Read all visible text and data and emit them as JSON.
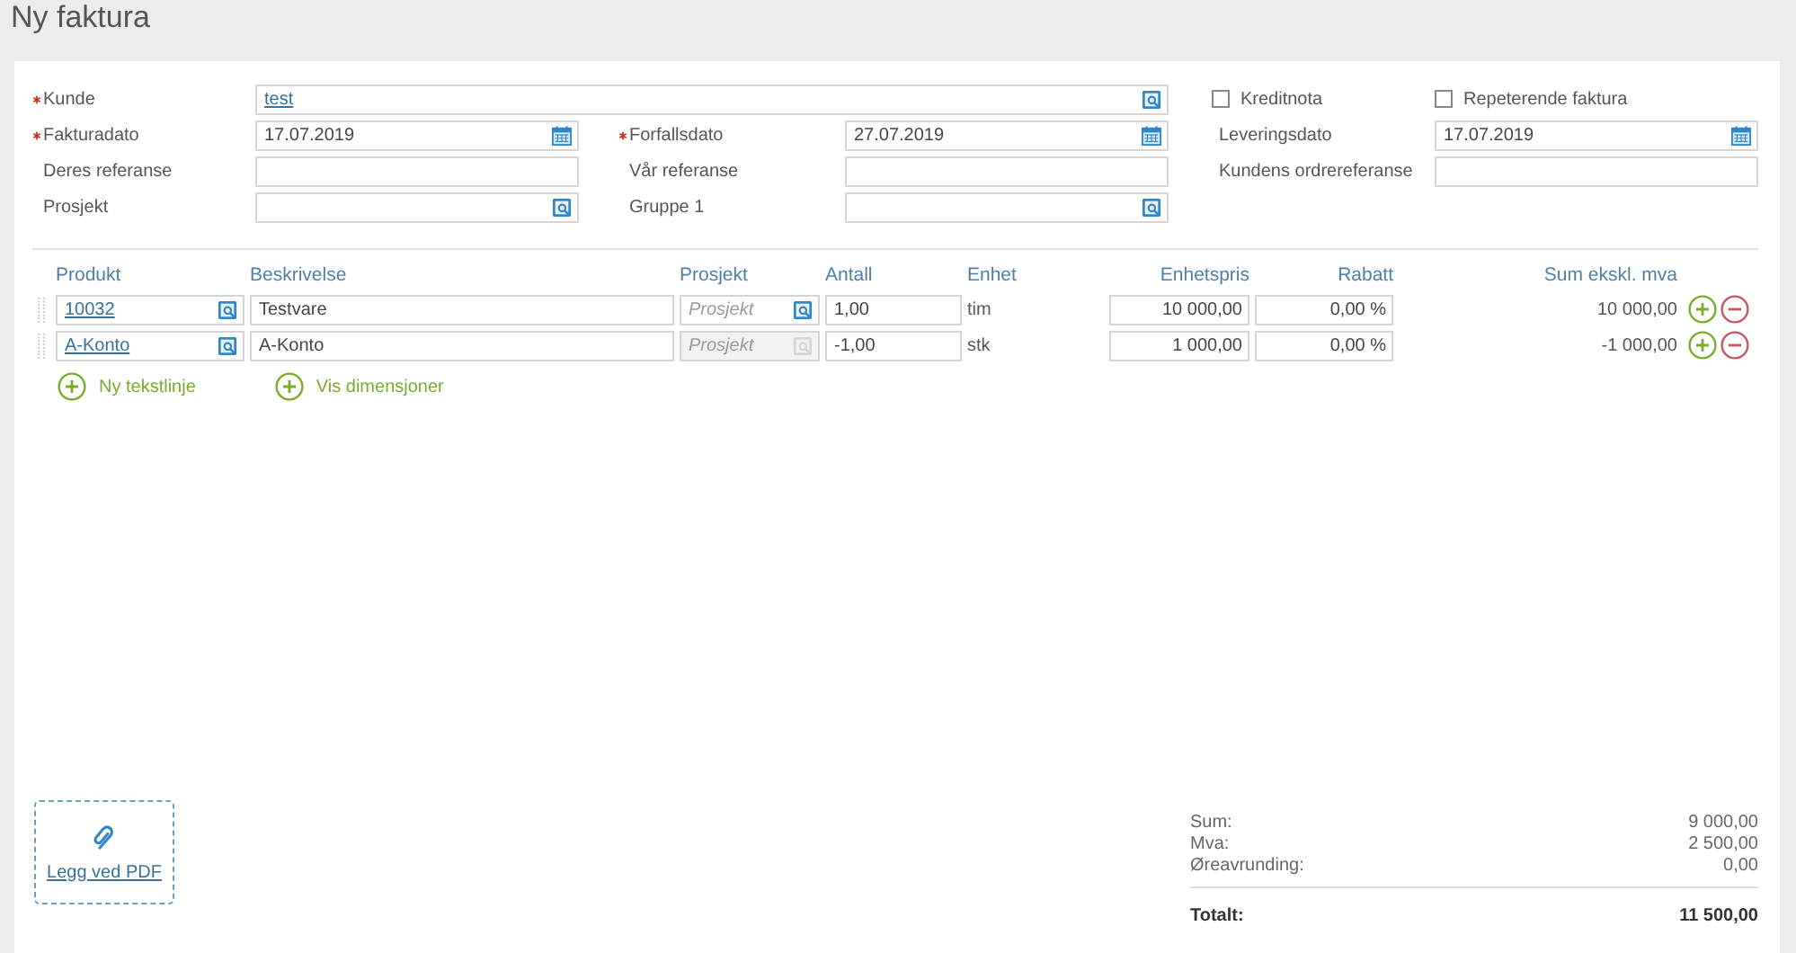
{
  "title": "Ny faktura",
  "form_rows": [
    [
      {
        "kind": "lookup_field",
        "label": "Kunde",
        "required": true,
        "value": "test",
        "link": true,
        "wide": true
      },
      {
        "kind": "checkbox",
        "label": "Kreditnota",
        "checked": false
      },
      {
        "kind": "checkbox",
        "label": "Repeterende faktura",
        "checked": false
      }
    ],
    [
      {
        "kind": "date_field",
        "label": "Fakturadato",
        "required": true,
        "value": "17.07.2019"
      },
      {
        "kind": "date_field",
        "label": "Forfallsdato",
        "required": true,
        "value": "27.07.2019"
      },
      {
        "kind": "date_field",
        "label": "Leveringsdato",
        "required": false,
        "value": "17.07.2019"
      }
    ],
    [
      {
        "kind": "text_field",
        "label": "Deres referanse",
        "required": false
      },
      {
        "kind": "text_field",
        "label": "Vår referanse",
        "required": false
      },
      {
        "kind": "text_field",
        "label": "Kundens ordrereferanse",
        "required": false
      }
    ],
    [
      {
        "kind": "lookup_field",
        "label": "Prosjekt",
        "required": false
      },
      {
        "kind": "lookup_field",
        "label": "Gruppe 1",
        "required": false
      }
    ]
  ],
  "columns": [
    "Produkt",
    "Beskrivelse",
    "Prosjekt",
    "Antall",
    "Enhet",
    "Enhetspris",
    "Rabatt",
    "Sum ekskl. mva"
  ],
  "lines": [
    {
      "product": "10032",
      "description": "Testvare",
      "project_placeholder": "Prosjekt",
      "project_disabled": false,
      "quantity": "1,00",
      "unit": "tim",
      "unit_price": "10 000,00",
      "discount": "0,00 %",
      "sum": "10 000,00"
    },
    {
      "product": "A-Konto",
      "description": "A-Konto",
      "project_placeholder": "Prosjekt",
      "project_disabled": true,
      "quantity": "-1,00",
      "unit": "stk",
      "unit_price": "1 000,00",
      "discount": "0,00 %",
      "sum": "-1 000,00"
    }
  ],
  "actions": [
    "Ny tekstlinje",
    "Vis dimensjoner"
  ],
  "attachment": {
    "label": "Legg ved PDF"
  },
  "totals": [
    {
      "label": "Sum:",
      "value": "9 000,00"
    },
    {
      "label": "Mva:",
      "value": "2 500,00"
    },
    {
      "label": "Øreavrunding:",
      "value": "0,00"
    }
  ],
  "total": {
    "label": "Totalt:",
    "value": "11 500,00"
  }
}
